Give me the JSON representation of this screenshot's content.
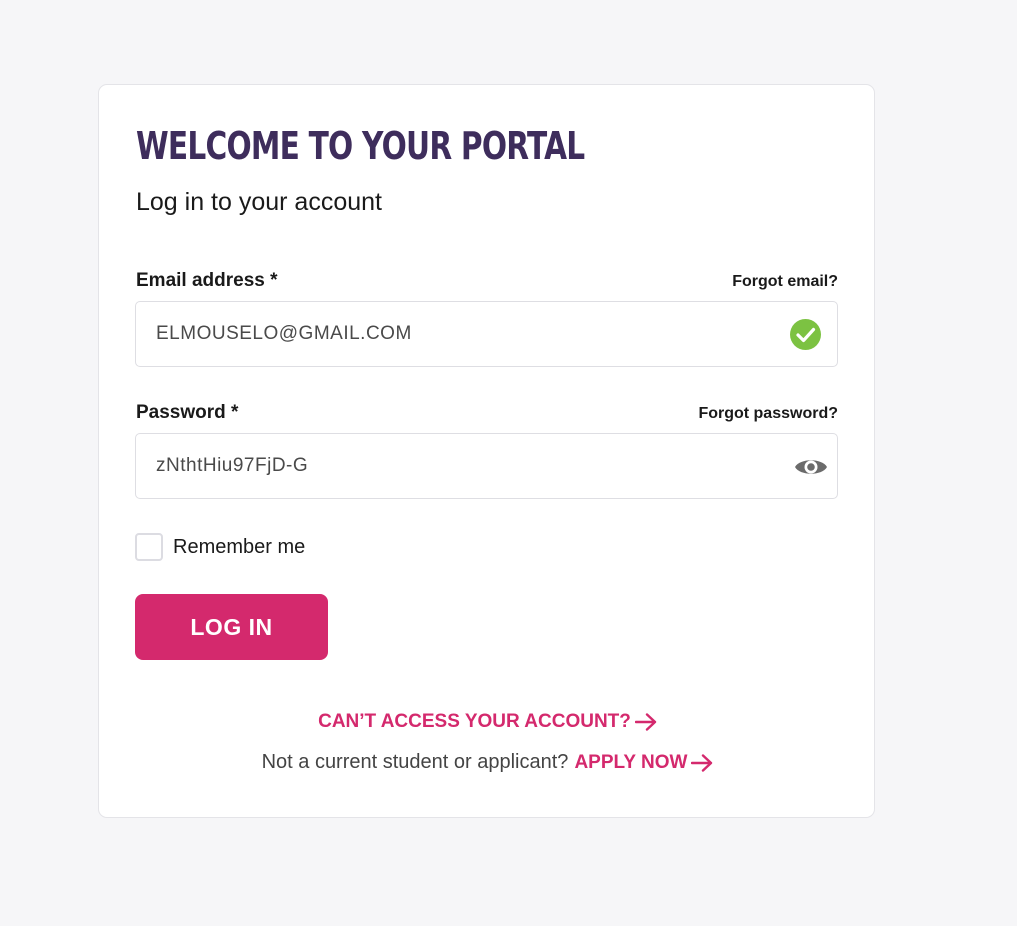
{
  "card": {
    "title": "WELCOME TO YOUR PORTAL",
    "subtitle": "Log in to your account"
  },
  "email": {
    "label": "Email address *",
    "forgot_link": "Forgot email?",
    "value": "ELMOUSELO@GMAIL.COM",
    "status_icon": "check-circle-icon"
  },
  "password": {
    "label": "Password *",
    "forgot_link": "Forgot password?",
    "value": "zNthtHiu97FjD-G",
    "toggle_icon": "eye-icon"
  },
  "remember": {
    "label": "Remember me",
    "checked": false
  },
  "login_button": "LOG IN",
  "footer": {
    "cant_access": "CAN’T ACCESS YOUR ACCOUNT?",
    "not_student": "Not a current student or applicant?",
    "apply_now": "APPLY NOW"
  },
  "colors": {
    "accent": "#d4296d",
    "title": "#3e2d5c",
    "success": "#7cc242",
    "background": "#f6f6f8"
  }
}
